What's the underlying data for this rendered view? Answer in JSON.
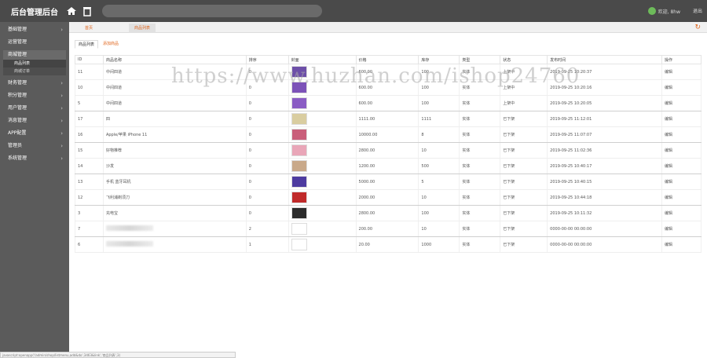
{
  "app": {
    "title": "后台管理后台",
    "search_placeholder": ""
  },
  "user": {
    "greeting": "欢迎, 8hw",
    "logout": "退出"
  },
  "sidebar": {
    "items": [
      {
        "label": "基础管理",
        "chevron": "›"
      },
      {
        "label": "运营管理",
        "chevron": ""
      },
      {
        "label": "商城管理",
        "chevron": ""
      },
      {
        "label": "财务管理",
        "chevron": "›"
      },
      {
        "label": "积分管理",
        "chevron": "›"
      },
      {
        "label": "用户管理",
        "chevron": "›"
      },
      {
        "label": "消息管理",
        "chevron": "›"
      },
      {
        "label": "APP配置",
        "chevron": "›"
      },
      {
        "label": "管理员",
        "chevron": "›"
      },
      {
        "label": "系统管理",
        "chevron": "›"
      }
    ],
    "subitems": [
      {
        "label": "商品列表"
      },
      {
        "label": "商城订单"
      }
    ]
  },
  "tabs": {
    "home": "首页",
    "current": "商品列表"
  },
  "subtabs": {
    "list": "商品列表",
    "add": "添加商品"
  },
  "table": {
    "headers": [
      "ID",
      "商品名称",
      "排序",
      "封面",
      "价格",
      "库存",
      "类型",
      "状态",
      "发布时间",
      "操作"
    ],
    "rows": [
      {
        "id": "11",
        "name": "中间四道",
        "sort": "0",
        "price": "600.00",
        "stock": "100",
        "type": "实体",
        "status": "上架中",
        "time": "2019-09-25 10:20:37",
        "op": "编辑",
        "thumb": "#6d4fa8"
      },
      {
        "id": "10",
        "name": "中间四道",
        "sort": "0",
        "price": "600.00",
        "stock": "100",
        "type": "实体",
        "status": "上架中",
        "time": "2019-09-25 10:20:16",
        "op": "编辑",
        "thumb": "#7c52b8"
      },
      {
        "id": "5",
        "name": "中间四道",
        "sort": "0",
        "price": "600.00",
        "stock": "100",
        "type": "实体",
        "status": "上架中",
        "time": "2019-09-25 10:20:05",
        "op": "编辑",
        "thumb": "#8a5cc4"
      },
      {
        "id": "17",
        "name": "四",
        "sort": "0",
        "price": "1111.00",
        "stock": "1111",
        "type": "实体",
        "status": "已下架",
        "time": "2019-09-25 11:12:01",
        "op": "编辑",
        "thumb": "#d9cda0"
      },
      {
        "id": "16",
        "name": "Apple/苹果 iPhone 11",
        "sort": "0",
        "price": "10000.00",
        "stock": "8",
        "type": "实体",
        "status": "已下架",
        "time": "2019-09-25 11:07:07",
        "op": "编辑",
        "thumb": "#c95e7a"
      },
      {
        "id": "15",
        "name": "好物推荐",
        "sort": "0",
        "price": "2800.00",
        "stock": "10",
        "type": "实体",
        "status": "已下架",
        "time": "2019-09-25 11:02:36",
        "op": "编辑",
        "thumb": "#e9a6b8"
      },
      {
        "id": "14",
        "name": "沙发",
        "sort": "0",
        "price": "1200.00",
        "stock": "500",
        "type": "实体",
        "status": "已下架",
        "time": "2019-09-25 10:40:17",
        "op": "编辑",
        "thumb": "#c9a98a"
      },
      {
        "id": "13",
        "name": "手机 蓝牙耳机",
        "sort": "0",
        "price": "5000.00",
        "stock": "5",
        "type": "实体",
        "status": "已下架",
        "time": "2019-09-25 10:40:15",
        "op": "编辑",
        "thumb": "#4d3ba0"
      },
      {
        "id": "12",
        "name": "飞利浦剃须刀",
        "sort": "0",
        "price": "2000.00",
        "stock": "10",
        "type": "实体",
        "status": "已下架",
        "time": "2019-09-25 10:44:18",
        "op": "编辑",
        "thumb": "#c02a2a"
      },
      {
        "id": "3",
        "name": "充电宝",
        "sort": "0",
        "price": "2800.00",
        "stock": "100",
        "type": "实体",
        "status": "已下架",
        "time": "2019-09-25 10:11:32",
        "op": "编辑",
        "thumb": "#2b2b2b"
      },
      {
        "id": "7",
        "name": "",
        "sort": "2",
        "price": "200.00",
        "stock": "10",
        "type": "实体",
        "status": "已下架",
        "time": "0000-00-00 00:00:00",
        "op": "编辑",
        "thumb": "#ffffff"
      },
      {
        "id": "6",
        "name": "",
        "sort": "1",
        "price": "20.00",
        "stock": "1000",
        "type": "实体",
        "status": "已下架",
        "time": "0000-00-00 00:00:00",
        "op": "编辑",
        "thumb": "#ffffff"
      }
    ]
  },
  "watermark": "https://www.huzhan.com/ishop24760",
  "status_url": "javascript:openapp('/admin/shop/listmenu,add&do',3463&link','商品列表',3)"
}
